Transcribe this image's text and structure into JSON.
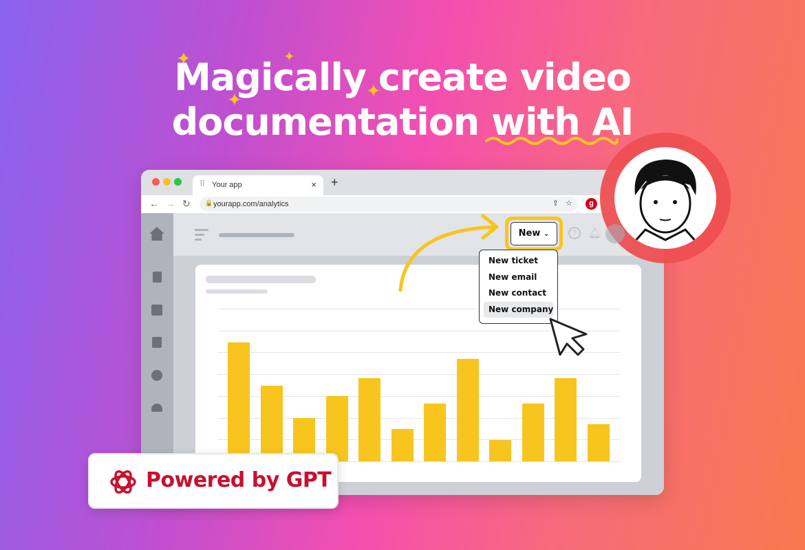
{
  "headline": {
    "line1": "Magically create video",
    "line2_prefix": "documentation ",
    "line2_highlight": "with AI"
  },
  "browser": {
    "tab_title": "Your app",
    "tab_close": "×",
    "new_tab": "+",
    "url": "yourapp.com/analytics"
  },
  "app": {
    "new_button": "New",
    "menu_items": [
      "New ticket",
      "New email",
      "New contact",
      "New company"
    ],
    "hovered_item": "New company"
  },
  "chart_data": {
    "type": "bar",
    "title": "",
    "xlabel": "",
    "ylabel": "",
    "grid": true,
    "values": [
      173,
      110,
      63,
      95,
      121,
      47,
      84,
      149,
      31,
      84,
      121,
      54
    ]
  },
  "badge": {
    "label": "Powered by GPT"
  },
  "colors": {
    "accent": "#f8c51f",
    "badge_text": "#c8102e",
    "avatar_ring": "#ee4f52"
  }
}
